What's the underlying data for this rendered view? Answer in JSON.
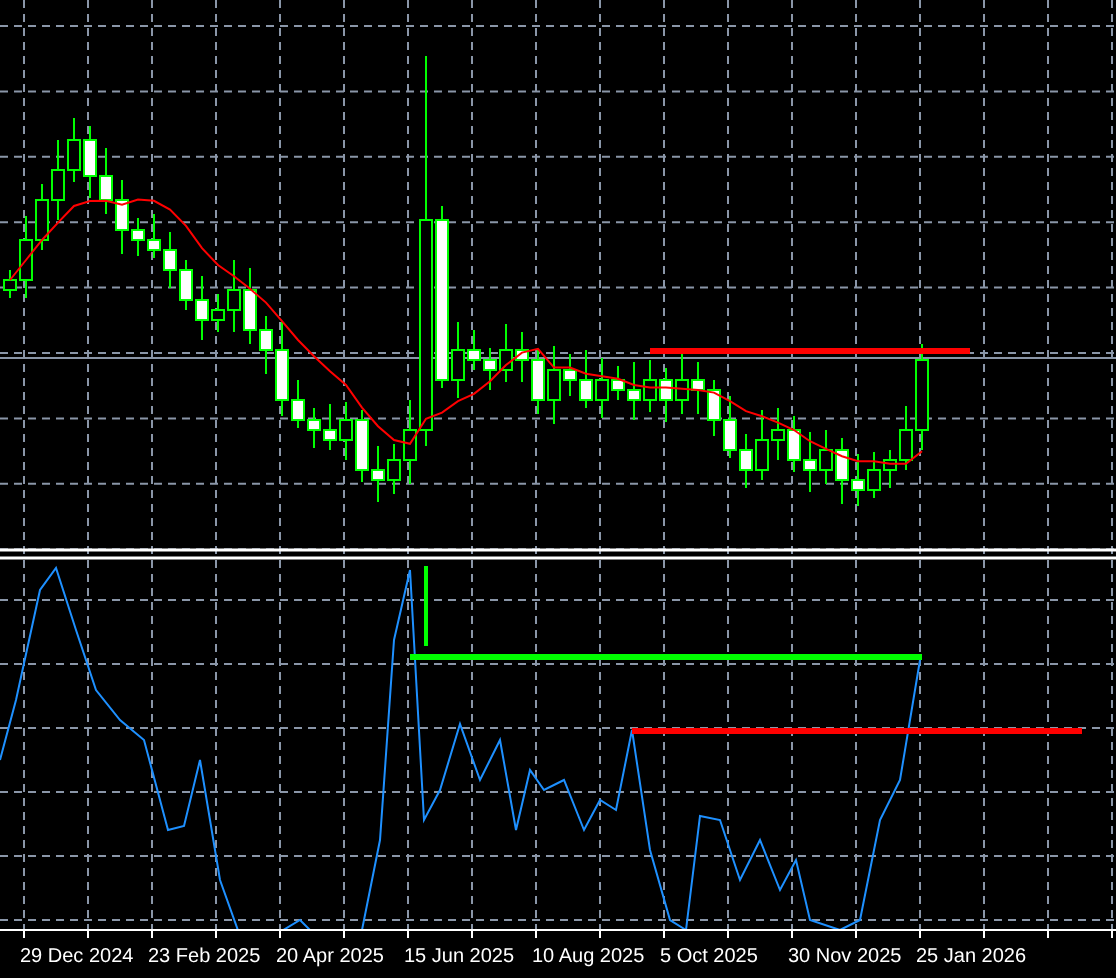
{
  "x_axis": {
    "labels": [
      "29 Dec 2024",
      "23 Feb 2025",
      "20 Apr 2025",
      "15 Jun 2025",
      "10 Aug 2025",
      "5 Oct 2025",
      "30 Nov 2025",
      "25 Jan 2026"
    ]
  }
}
